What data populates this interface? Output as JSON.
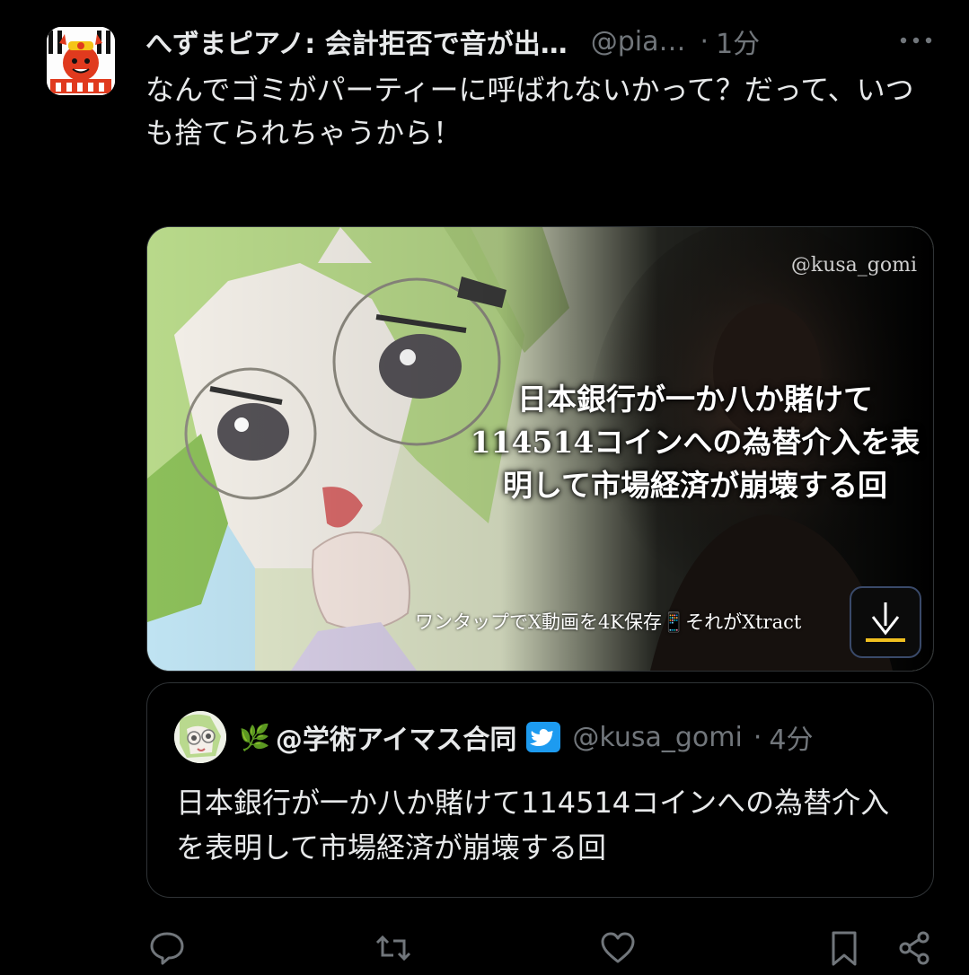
{
  "tweet": {
    "display_name": "へずまピアノ: 会計拒否で音が出…",
    "handle": "@pia…",
    "dot": "·",
    "time": "1分",
    "text": "なんでゴミがパーティーに呼ばれないかって？だって、いつも捨てられちゃうから！"
  },
  "media": {
    "watermark": "@kusa_gomi",
    "caption_line1": "日本銀行が一か八か賭けて",
    "caption_line2": "114514コインへの為替介入を表",
    "caption_line3": "明して市場経済が崩壊する回",
    "promo": "ワンタップでX動画を4K保存📱それがXtract"
  },
  "quote": {
    "emoji": "🌿",
    "display_name": "@学術アイマス合同",
    "handle": "@kusa_gomi",
    "dot": "·",
    "time": "4分",
    "text": "日本銀行が一か八か賭けて114514コインへの為替介入を表明して市場経済が崩壊する回"
  },
  "icons": {
    "more": "more-icon",
    "reply": "reply-icon",
    "retweet": "retweet-icon",
    "like": "like-icon",
    "bookmark": "bookmark-icon",
    "share": "share-icon",
    "verified": "verified-bird-icon",
    "download": "download-icon"
  },
  "colors": {
    "background": "#000000",
    "text": "#e7e9ea",
    "muted": "#71767b",
    "border": "#2f3336",
    "verified_blue": "#1d9bf0"
  }
}
